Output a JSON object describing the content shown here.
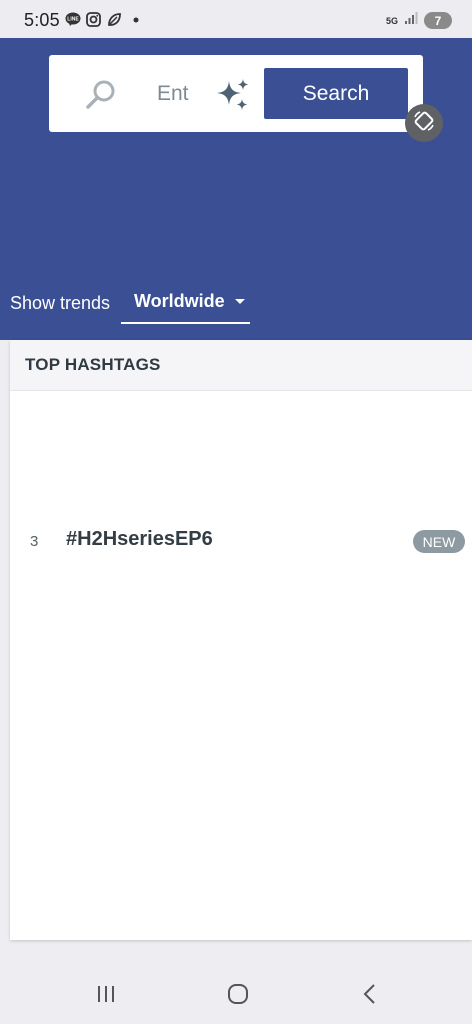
{
  "status_bar": {
    "time": "5:05",
    "network": "5G",
    "battery": "7",
    "icons": [
      "line-app-icon",
      "instagram-icon",
      "leaf-icon",
      "dot-icon"
    ]
  },
  "search": {
    "placeholder": "Ent",
    "button_label": "Search"
  },
  "trends": {
    "label": "Show trends",
    "region": "Worldwide"
  },
  "top_hashtags": {
    "title": "TOP HASHTAGS",
    "items": [
      {
        "rank": "3",
        "tag": "#H2HseriesEP6",
        "badge": "NEW"
      }
    ]
  },
  "colors": {
    "brand": "#3a4f94",
    "badge": "#8e9aa2",
    "background": "#eeeef2"
  }
}
